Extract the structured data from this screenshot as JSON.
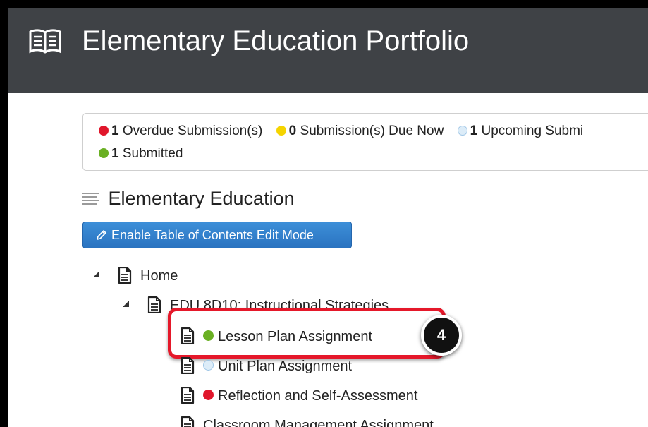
{
  "header": {
    "title": "Elementary Education Portfolio",
    "icon": "book-open-icon"
  },
  "status": {
    "overdue": {
      "count": "1",
      "label": "Overdue Submission(s)",
      "color": "#e0162b"
    },
    "due_now": {
      "count": "0",
      "label": "Submission(s) Due Now",
      "color": "#f5d400"
    },
    "upcoming": {
      "count": "1",
      "label": "Upcoming Submi",
      "color": "#dcecf8"
    },
    "submitted": {
      "count": "1",
      "label": "Submitted",
      "color": "#6ab023"
    }
  },
  "section": {
    "title": "Elementary Education",
    "icon": "list-icon"
  },
  "edit_button": {
    "label": "Enable Table of Contents Edit Mode",
    "icon": "pencil-icon",
    "color": "#2a73c0"
  },
  "tree": {
    "home": "Home",
    "course": "EDU 8D10: Instructional Strategies",
    "items": [
      {
        "label": "Lesson Plan Assignment",
        "status": "submitted"
      },
      {
        "label": "Unit Plan Assignment",
        "status": "upcoming"
      },
      {
        "label": "Reflection and Self-Assessment",
        "status": "overdue"
      },
      {
        "label": "Classroom Management Assignment",
        "status": "none"
      }
    ]
  },
  "callout": {
    "step": "4",
    "highlight_color": "#e5182a"
  }
}
